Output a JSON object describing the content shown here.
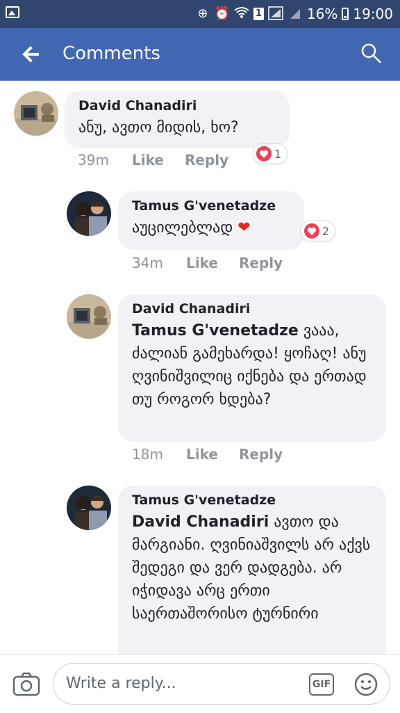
{
  "status_bar": {
    "sim_badge": "1",
    "battery": "16%",
    "time": "19:00"
  },
  "header": {
    "title": "Comments"
  },
  "comments": [
    {
      "author": "David Chanadiri",
      "mention": "",
      "text": "ანუ, ავთო მიდის, ხო?",
      "time": "39m",
      "like": "Like",
      "reply": "Reply",
      "reaction_count": "1"
    },
    {
      "author": "Tamus G'venetadze",
      "mention": "",
      "text": "აუცილებლად",
      "emoji": "❤",
      "time": "34m",
      "like": "Like",
      "reply": "Reply",
      "reaction_count": "2"
    },
    {
      "author": "David Chanadiri",
      "mention": "Tamus G'venetadze",
      "text": "ვააა, ძალიან გამეხარდა! ყოჩაღ! ანუ ღვინიშვილიც იქნება და ერთად თუ როგორ ხდება?",
      "time": "18m",
      "like": "Like",
      "reply": "Reply"
    },
    {
      "author": "Tamus G'venetadze",
      "mention": "David Chanadiri",
      "text": "ავთო და მარგიანი. ღვინიაშვილს არ აქვს შედეგი და ვერ დადგება. არ იჭიდავა არც ერთი საერთაშორისო ტურნირი"
    }
  ],
  "composer": {
    "placeholder": "Write a reply...",
    "gif_label": "GIF"
  },
  "colors": {
    "status_bar": "#30466e",
    "app_bar": "#4267b2",
    "bubble": "#f1f2f6",
    "heart": "#f33e58"
  }
}
